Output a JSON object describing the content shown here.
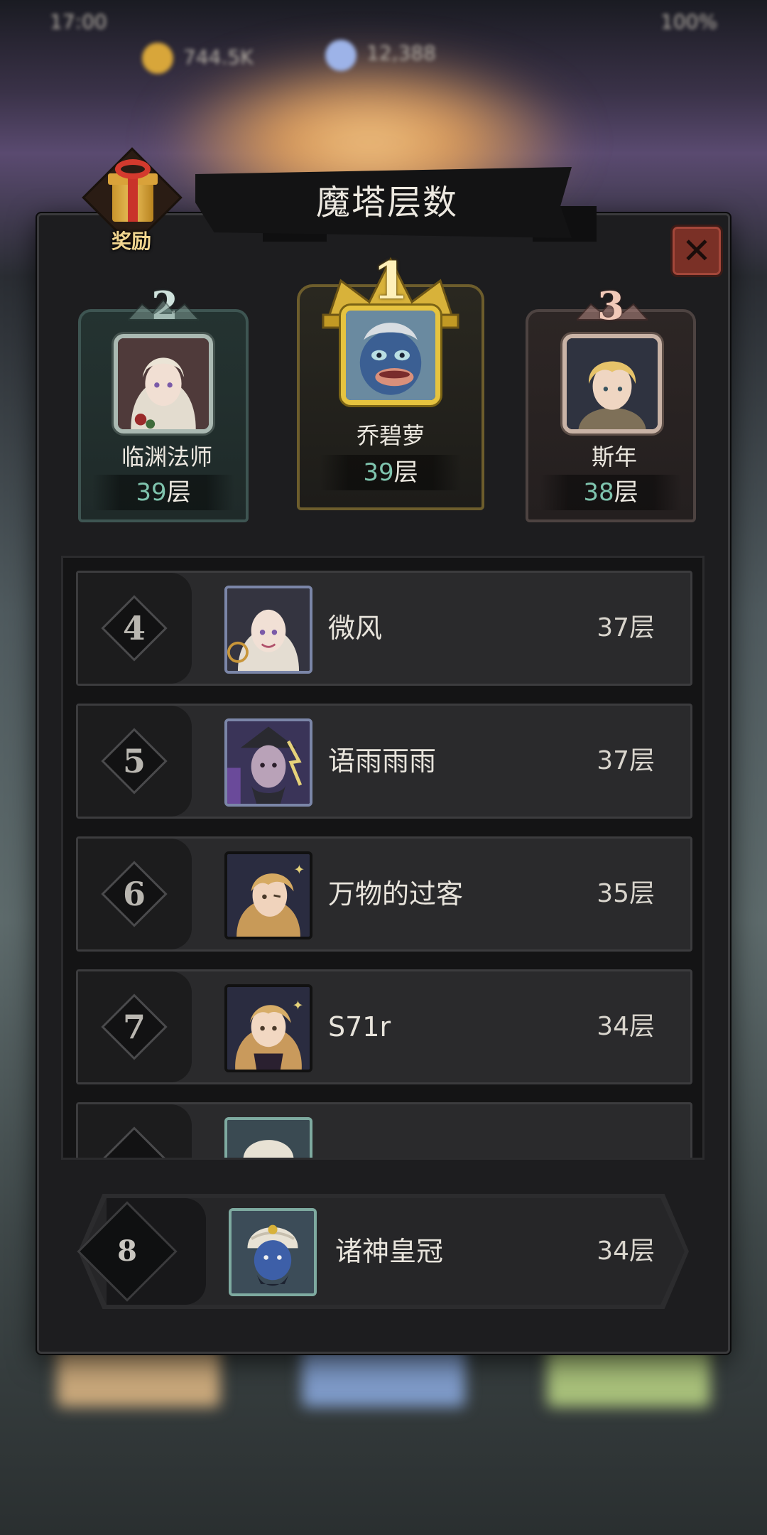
{
  "status_bar": {
    "time": "17:00",
    "battery": "100%"
  },
  "top_resources": {
    "gold": "744.5K",
    "gems": "12,388"
  },
  "panel": {
    "title": "魔塔层数",
    "reward_label": "奖励"
  },
  "podium": [
    {
      "rank": "2",
      "name": "临渊法师",
      "floor": "39",
      "unit": "层"
    },
    {
      "rank": "1",
      "name": "乔碧萝",
      "floor": "39",
      "unit": "层"
    },
    {
      "rank": "3",
      "name": "斯年",
      "floor": "38",
      "unit": "层"
    }
  ],
  "ranking": [
    {
      "rank": "4",
      "name": "微风",
      "score": "37层"
    },
    {
      "rank": "5",
      "name": "语雨雨雨",
      "score": "37层"
    },
    {
      "rank": "6",
      "name": "万物的过客",
      "score": "35层"
    },
    {
      "rank": "7",
      "name": "S71r",
      "score": "34层"
    },
    {
      "rank": "",
      "name": "",
      "score": ""
    }
  ],
  "my_rank": {
    "rank": "8",
    "name": "诸神皇冠",
    "score": "34层"
  },
  "colors": {
    "score_accent": "#7fc4ae",
    "gold_frame": "#e6c33f",
    "close_button": "#7a3026"
  },
  "icons": {
    "close": "close-x-icon",
    "reward": "gift-box-icon",
    "crown": "crown-icon"
  }
}
